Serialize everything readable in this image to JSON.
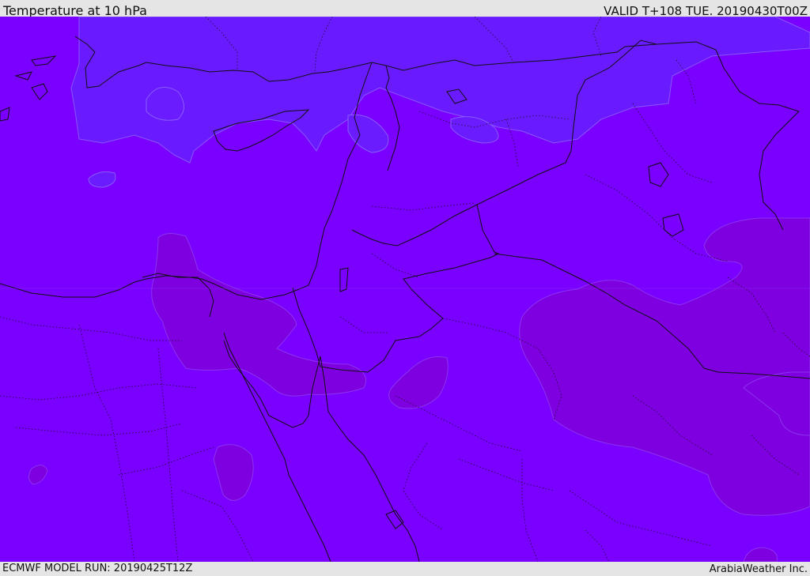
{
  "header": {
    "title": "Temperature at 10 hPa",
    "valid_time": "VALID T+108 TUE. 20190430T00Z"
  },
  "footer": {
    "model_run": "ECMWF MODEL RUN: 20190425T12Z",
    "credit": "ArabiaWeather Inc."
  },
  "map": {
    "colors": {
      "base_field": "#7a00ff",
      "cooler_field": "#6a1cff",
      "warmer_field": "#7e00e0",
      "border_lines": "#111111"
    }
  }
}
